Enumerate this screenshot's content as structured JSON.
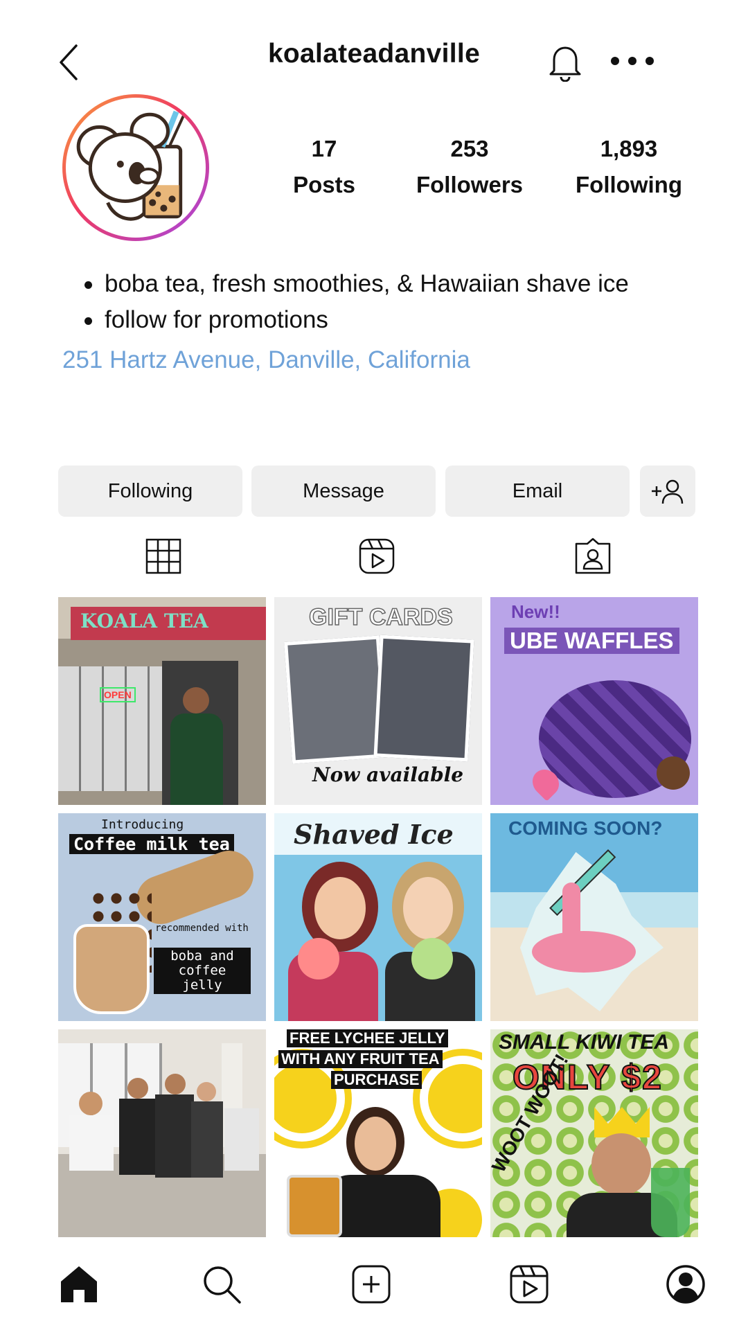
{
  "profile": {
    "username": "koalateadanville",
    "stats": [
      {
        "value": "17",
        "label": "Posts"
      },
      {
        "value": "253",
        "label": "Followers"
      },
      {
        "value": "1,893",
        "label": "Following"
      }
    ],
    "bio": [
      "boba tea, fresh smoothies, & Hawaiian shave ice",
      "follow for promotions"
    ],
    "address": "251 Hartz Avenue, Danville, California"
  },
  "buttons": {
    "following": "Following",
    "message": "Message",
    "email": "Email"
  },
  "posts": [
    {
      "caption": "KOALA TEA",
      "sub": "OPEN"
    },
    {
      "caption": "GIFT CARDS",
      "sub": "Now available"
    },
    {
      "caption": "UBE WAFFLES",
      "sub": "New!!"
    },
    {
      "caption": "Coffee milk tea",
      "sub": "Introducing",
      "extra": "recommended with",
      "extra2": "boba and coffee jelly"
    },
    {
      "caption": "Shaved Ice"
    },
    {
      "caption": "COMING SOON?"
    },
    {
      "caption": ""
    },
    {
      "caption": "FREE LYCHEE JELLY",
      "sub": "WITH ANY FRUIT TEA",
      "extra": "PURCHASE"
    },
    {
      "caption": "SMALL KIWI TEA",
      "sub": "ONLY $2",
      "extra": "WOOT WOOT!"
    }
  ],
  "colors": {
    "link": "#6fa2d8",
    "button_bg": "#efefef"
  },
  "icons": {
    "back": "chevron-left-icon",
    "bell": "bell-icon",
    "more": "more-dots-icon",
    "add_user": "add-user-icon",
    "grid_tab": "grid-icon",
    "reels_tab": "reels-icon",
    "tagged_tab": "tagged-icon",
    "home": "home-icon",
    "search": "search-icon",
    "create": "plus-square-icon",
    "reels": "reels-icon",
    "profile": "profile-icon"
  }
}
